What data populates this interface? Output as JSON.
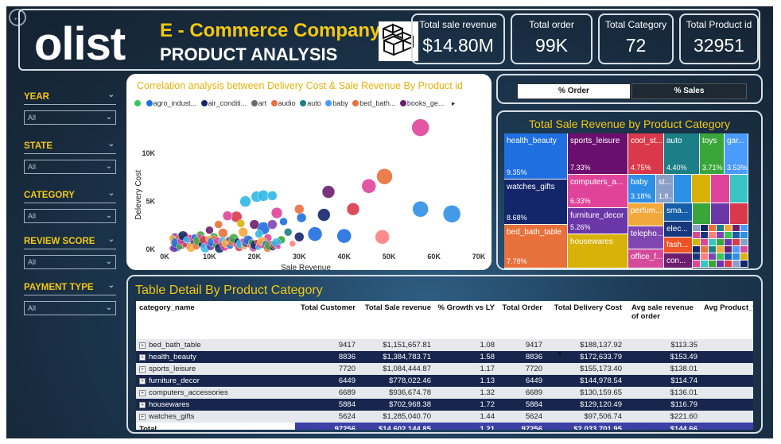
{
  "header": {
    "logo": "olist",
    "title_line1": "E - Commerce Company",
    "title_line2": "PRODUCT ANALYSIS"
  },
  "kpis": [
    {
      "label": "Total sale revenue",
      "value": "$14.80M"
    },
    {
      "label": "Total order",
      "value": "99K"
    },
    {
      "label": "Total Category",
      "value": "72"
    },
    {
      "label": "Total Product id",
      "value": "32951"
    }
  ],
  "filters": [
    {
      "label": "YEAR",
      "value": "All"
    },
    {
      "label": "STATE",
      "value": "All"
    },
    {
      "label": "CATEGORY",
      "value": "All"
    },
    {
      "label": "REVIEW SCORE",
      "value": "All"
    },
    {
      "label": "PAYMENT TYPE",
      "value": "All"
    }
  ],
  "toggle": {
    "order": "% Order",
    "sales": "% Sales"
  },
  "treemap": {
    "title": "Total Sale Revenue by Product Category",
    "tiles": [
      {
        "name": "health_beauty",
        "pct": "9.35%",
        "color": "#1f6fe0"
      },
      {
        "name": "watches_gifts",
        "pct": "8.68%",
        "color": "#14266b"
      },
      {
        "name": "bed_bath_table",
        "pct": "7.78%",
        "color": "#e8703a"
      },
      {
        "name": "sports_leisure",
        "pct": "7.33%",
        "color": "#6b0f6f"
      },
      {
        "name": "computers_a...",
        "pct": "6.33%",
        "color": "#e0449a"
      },
      {
        "name": "furniture_decor",
        "pct": "5.26%",
        "color": "#6a36a8"
      },
      {
        "name": "housewares",
        "pct": "",
        "color": "#d8b208"
      },
      {
        "name": "cool_st...",
        "pct": "4.75%",
        "color": "#d9394b"
      },
      {
        "name": "auto",
        "pct": "4.40%",
        "color": "#1c7f87"
      },
      {
        "name": "toys",
        "pct": "3.71%",
        "color": "#3aa63a"
      },
      {
        "name": "gar...",
        "pct": "3.53%",
        "color": "#4b9bff"
      },
      {
        "name": "baby",
        "pct": "3.18%",
        "color": "#2e8fe6"
      },
      {
        "name": "st...",
        "pct": "1.8...",
        "color": "#8aa0c8"
      },
      {
        "name": "perfum...",
        "pct": "",
        "color": "#f2a93b"
      },
      {
        "name": "telepho...",
        "pct": "",
        "color": "#7d46b0"
      },
      {
        "name": "office_f...",
        "pct": "",
        "color": "#d64a9c"
      },
      {
        "name": "sma...",
        "pct": "",
        "color": "#175ea8"
      },
      {
        "name": "elec...",
        "pct": "",
        "color": "#18367c"
      },
      {
        "name": "fash...",
        "pct": "",
        "color": "#f05323"
      },
      {
        "name": "con...",
        "pct": "",
        "color": "#6b1e6e"
      }
    ]
  },
  "scatter": {
    "title": "Correlation analysis between Delivery Cost & Sale Revenue By Product id",
    "legend": [
      {
        "name": "",
        "color": "#3ac45a"
      },
      {
        "name": "agro_indust...",
        "color": "#1f6fe0"
      },
      {
        "name": "air_conditi...",
        "color": "#14266b"
      },
      {
        "name": "art",
        "color": "#6a6a6a"
      },
      {
        "name": "audio",
        "color": "#e8703a"
      },
      {
        "name": "auto",
        "color": "#1c7f87"
      },
      {
        "name": "baby",
        "color": "#4b9bff"
      },
      {
        "name": "bed_bath...",
        "color": "#e8703a"
      },
      {
        "name": "books_ge...",
        "color": "#6b1e6e"
      }
    ],
    "more_icon": "caret-right-icon"
  },
  "chart_data": {
    "type": "scatter",
    "title": "Correlation analysis between Delivery Cost & Sale Revenue By Product id",
    "xlabel": "Sale Revenue",
    "ylabel": "Delevery Cost",
    "xlim": [
      0,
      70000
    ],
    "ylim": [
      0,
      13000
    ],
    "xticks": [
      "0K",
      "10K",
      "20K",
      "30K",
      "40K",
      "50K",
      "60K",
      "70K"
    ],
    "yticks": [
      "0K",
      "5K",
      "10K"
    ],
    "points": [
      {
        "x": 57000,
        "y": 12700,
        "r": 11,
        "color": "#e0449a"
      },
      {
        "x": 49000,
        "y": 7600,
        "r": 10,
        "color": "#e8703a"
      },
      {
        "x": 45500,
        "y": 6600,
        "r": 9,
        "color": "#e0449a"
      },
      {
        "x": 36500,
        "y": 6000,
        "r": 8,
        "color": "#6b1e6e"
      },
      {
        "x": 57000,
        "y": 4200,
        "r": 10,
        "color": "#2e8fe6"
      },
      {
        "x": 64000,
        "y": 3700,
        "r": 11,
        "color": "#2e8fe6"
      },
      {
        "x": 42000,
        "y": 4200,
        "r": 8,
        "color": "#d9394b"
      },
      {
        "x": 35500,
        "y": 3600,
        "r": 8,
        "color": "#14266b"
      },
      {
        "x": 30500,
        "y": 3300,
        "r": 6,
        "color": "#1f6fe0"
      },
      {
        "x": 30000,
        "y": 4200,
        "r": 6,
        "color": "#e8703a"
      },
      {
        "x": 33500,
        "y": 1600,
        "r": 9,
        "color": "#1f6fe0"
      },
      {
        "x": 40000,
        "y": 1400,
        "r": 9,
        "color": "#1f6fe0"
      },
      {
        "x": 48500,
        "y": 1300,
        "r": 9,
        "color": "#ff7f7f"
      },
      {
        "x": 30000,
        "y": 1300,
        "r": 6,
        "color": "#14266b"
      },
      {
        "x": 26000,
        "y": 1000,
        "r": 5,
        "color": "#3aa63a"
      },
      {
        "x": 22000,
        "y": 2200,
        "r": 8,
        "color": "#1f6fe0"
      },
      {
        "x": 20500,
        "y": 5500,
        "r": 7,
        "color": "#2eb8e6"
      },
      {
        "x": 22000,
        "y": 5600,
        "r": 7,
        "color": "#2eb8e6"
      },
      {
        "x": 24000,
        "y": 5600,
        "r": 6,
        "color": "#2eb8e6"
      },
      {
        "x": 18000,
        "y": 5000,
        "r": 7,
        "color": "#2eb8e6"
      },
      {
        "x": 25000,
        "y": 3800,
        "r": 7,
        "color": "#e0449a"
      },
      {
        "x": 16000,
        "y": 3400,
        "r": 7,
        "color": "#d9394b"
      },
      {
        "x": 14000,
        "y": 3500,
        "r": 6,
        "color": "#e0449a"
      },
      {
        "x": 20000,
        "y": 2600,
        "r": 6,
        "color": "#6b1e6e"
      },
      {
        "x": 17500,
        "y": 1800,
        "r": 6,
        "color": "#f2a93b"
      },
      {
        "x": 24000,
        "y": 2600,
        "r": 6,
        "color": "#7d46b0"
      },
      {
        "x": 27500,
        "y": 1800,
        "r": 5,
        "color": "#1c7f87"
      },
      {
        "x": 13000,
        "y": 1700,
        "r": 6,
        "color": "#e8703a"
      },
      {
        "x": 11000,
        "y": 1300,
        "r": 5,
        "color": "#3aa63a"
      },
      {
        "x": 9000,
        "y": 900,
        "r": 6,
        "color": "#6a36a8"
      },
      {
        "x": 7000,
        "y": 700,
        "r": 5,
        "color": "#f2a93b"
      },
      {
        "x": 5000,
        "y": 500,
        "r": 5,
        "color": "#d64a9c"
      },
      {
        "x": 3500,
        "y": 300,
        "r": 4,
        "color": "#1f6fe0"
      },
      {
        "x": 15000,
        "y": 800,
        "r": 5,
        "color": "#18367c"
      },
      {
        "x": 19000,
        "y": 900,
        "r": 5,
        "color": "#e0449a"
      },
      {
        "x": 21000,
        "y": 1600,
        "r": 5,
        "color": "#2eb8e6"
      },
      {
        "x": 12000,
        "y": 2600,
        "r": 5,
        "color": "#e8703a"
      },
      {
        "x": 10000,
        "y": 2000,
        "r": 5,
        "color": "#6b1e6e"
      },
      {
        "x": 8000,
        "y": 1500,
        "r": 5,
        "color": "#3aa63a"
      },
      {
        "x": 6000,
        "y": 1100,
        "r": 5,
        "color": "#d9394b"
      },
      {
        "x": 2000,
        "y": 200,
        "r": 3,
        "color": "#6a6a6a"
      },
      {
        "x": 4000,
        "y": 800,
        "r": 4,
        "color": "#4b9bff"
      },
      {
        "x": 17000,
        "y": 2700,
        "r": 5,
        "color": "#d8b208"
      },
      {
        "x": 23000,
        "y": 1200,
        "r": 5,
        "color": "#e0449a"
      },
      {
        "x": 26500,
        "y": 2900,
        "r": 5,
        "color": "#1f6fe0"
      },
      {
        "x": 28500,
        "y": 600,
        "r": 4,
        "color": "#ff7f7f"
      }
    ]
  },
  "table": {
    "title": "Table Detail By Product Category",
    "columns": [
      "category_name",
      "Total Customer",
      "Total Sale revenue",
      "% Growth vs LY",
      "Total Order",
      "Total Delivery Cost",
      "Avg sale revenue of order",
      "Avg Product_w"
    ],
    "rows": [
      [
        "bed_bath_table",
        "9417",
        "$1,151,657.81",
        "1.08",
        "9417",
        "$188,137.92",
        "$113.35",
        ""
      ],
      [
        "health_beauty",
        "8836",
        "$1,384,783.71",
        "1.58",
        "8836",
        "$172,633.79",
        "$153.49",
        ""
      ],
      [
        "sports_leisure",
        "7720",
        "$1,084,444.87",
        "1.17",
        "7720",
        "$155,173.40",
        "$138.01",
        ""
      ],
      [
        "furniture_decor",
        "6449",
        "$778,022.46",
        "1.13",
        "6449",
        "$144,978.54",
        "$114.74",
        ""
      ],
      [
        "computers_accessories",
        "6689",
        "$936,674.78",
        "1.32",
        "6689",
        "$130,159.65",
        "$136.01",
        ""
      ],
      [
        "housewares",
        "5884",
        "$702,968.38",
        "1.72",
        "5884",
        "$129,120.49",
        "$116.79",
        ""
      ],
      [
        "watches_gifts",
        "5624",
        "$1,285,040.70",
        "1.44",
        "5624",
        "$97,506.74",
        "$221.60",
        ""
      ]
    ],
    "total": [
      "Total",
      "97256",
      "$14,602,144.85",
      "1.21",
      "97256",
      "$2,033,701.95",
      "$144.66",
      ""
    ]
  }
}
